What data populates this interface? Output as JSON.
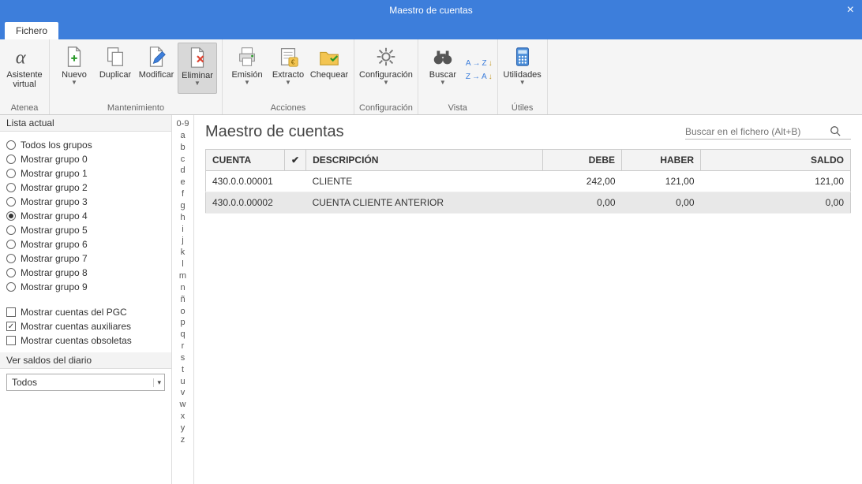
{
  "titlebar": {
    "title": "Maestro de cuentas"
  },
  "tab": {
    "label": "Fichero"
  },
  "ribbon": {
    "groups": [
      {
        "label": "Atenea",
        "items": [
          {
            "label": "Asistente\nvirtual",
            "icon": "alpha-icon",
            "dropdown": false
          }
        ]
      },
      {
        "label": "Mantenimiento",
        "items": [
          {
            "label": "Nuevo",
            "icon": "new-file-icon",
            "dropdown": true
          },
          {
            "label": "Duplicar",
            "icon": "duplicate-icon",
            "dropdown": false
          },
          {
            "label": "Modificar",
            "icon": "edit-icon",
            "dropdown": false
          },
          {
            "label": "Eliminar",
            "icon": "delete-icon",
            "dropdown": true,
            "selected": true
          }
        ]
      },
      {
        "label": "Acciones",
        "items": [
          {
            "label": "Emisión",
            "icon": "print-icon",
            "dropdown": true
          },
          {
            "label": "Extracto",
            "icon": "extract-icon",
            "dropdown": true
          },
          {
            "label": "Chequear",
            "icon": "folder-check-icon",
            "dropdown": false
          }
        ]
      },
      {
        "label": "Configuración",
        "items": [
          {
            "label": "Configuración",
            "icon": "gear-icon",
            "dropdown": true
          }
        ]
      },
      {
        "label": "Vista",
        "items": [
          {
            "label": "Buscar",
            "icon": "binoculars-icon",
            "dropdown": true,
            "az": true
          }
        ]
      },
      {
        "label": "Útiles",
        "items": [
          {
            "label": "Utilidades",
            "icon": "calculator-icon",
            "dropdown": true
          }
        ]
      }
    ]
  },
  "sidebar": {
    "list_title": "Lista actual",
    "radios": [
      {
        "label": "Todos los grupos",
        "checked": false
      },
      {
        "label": "Mostrar grupo 0",
        "checked": false
      },
      {
        "label": "Mostrar grupo 1",
        "checked": false
      },
      {
        "label": "Mostrar grupo 2",
        "checked": false
      },
      {
        "label": "Mostrar grupo 3",
        "checked": false
      },
      {
        "label": "Mostrar grupo 4",
        "checked": true
      },
      {
        "label": "Mostrar grupo 5",
        "checked": false
      },
      {
        "label": "Mostrar grupo 6",
        "checked": false
      },
      {
        "label": "Mostrar grupo 7",
        "checked": false
      },
      {
        "label": "Mostrar grupo 8",
        "checked": false
      },
      {
        "label": "Mostrar grupo 9",
        "checked": false
      }
    ],
    "checks": [
      {
        "label": "Mostrar cuentas del PGC",
        "checked": false
      },
      {
        "label": "Mostrar cuentas auxiliares",
        "checked": true
      },
      {
        "label": "Mostrar cuentas obsoletas",
        "checked": false
      }
    ],
    "diario_title": "Ver saldos del diario",
    "diario_value": "Todos"
  },
  "letters": [
    "0-9",
    "a",
    "b",
    "c",
    "d",
    "e",
    "f",
    "g",
    "h",
    "i",
    "j",
    "k",
    "l",
    "m",
    "n",
    "ñ",
    "o",
    "p",
    "q",
    "r",
    "s",
    "t",
    "u",
    "v",
    "w",
    "x",
    "y",
    "z"
  ],
  "main": {
    "title": "Maestro de cuentas",
    "search_placeholder": "Buscar en el fichero (Alt+B)",
    "columns": {
      "cuenta": "CUENTA",
      "check": "✔",
      "descripcion": "DESCRIPCIÓN",
      "debe": "DEBE",
      "haber": "HABER",
      "saldo": "SALDO"
    },
    "rows": [
      {
        "cuenta": "430.0.0.00001",
        "chk": "",
        "descripcion": "CLIENTE",
        "debe": "242,00",
        "haber": "121,00",
        "saldo": "121,00",
        "selected": false
      },
      {
        "cuenta": "430.0.0.00002",
        "chk": "",
        "descripcion": "CUENTA CLIENTE ANTERIOR",
        "debe": "0,00",
        "haber": "0,00",
        "saldo": "0,00",
        "selected": true
      }
    ]
  }
}
